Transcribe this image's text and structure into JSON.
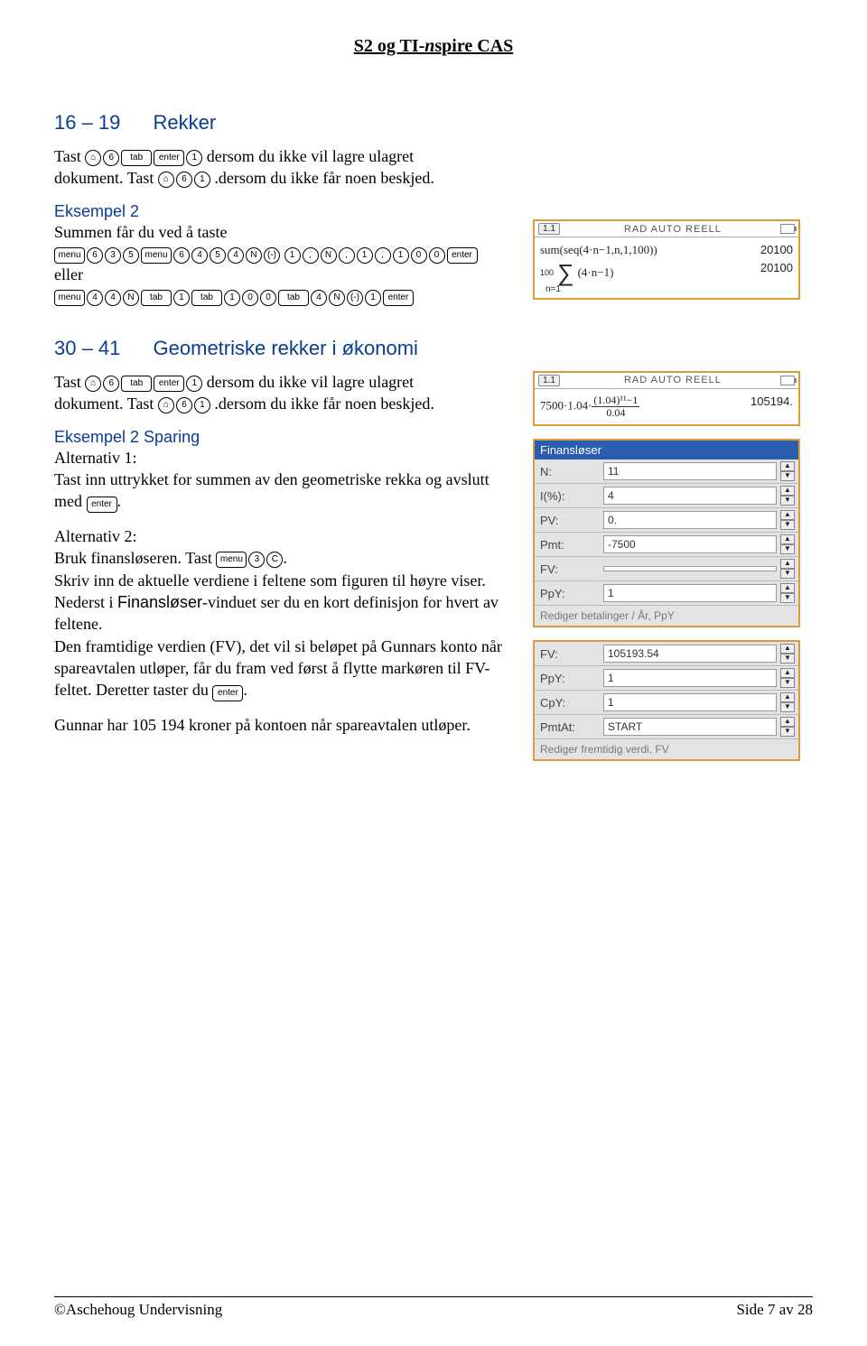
{
  "header": {
    "title_pre": "S2 og TI-",
    "title_n": "n",
    "title_post": "spire CAS"
  },
  "section1": {
    "num": "16 – 19",
    "title": "Rekker",
    "p1_a": "Tast ",
    "p1_keys": [
      "⌂",
      "6",
      "tab",
      "enter",
      "1"
    ],
    "p1_b": " dersom du ikke vil lagre ulagret",
    "p2_a": "dokument. Tast ",
    "p2_keys": [
      "⌂",
      "6",
      "1"
    ],
    "p2_b": ".dersom du ikke får noen beskjed.",
    "ex_title": "Eksempel 2",
    "ex_line1": "Summen får du ved å taste",
    "row1": [
      "menu",
      "6",
      "3",
      "5",
      "menu",
      "6",
      "4",
      "5",
      "4",
      "N",
      "(-)"
    ],
    "row2": [
      "1",
      ",",
      "N",
      ",",
      "1",
      ",",
      "1",
      "0",
      "0",
      "enter"
    ],
    "eller": "eller",
    "row3": [
      "menu",
      "4",
      "4",
      "N",
      "tab",
      "1",
      "tab",
      "1",
      "0",
      "0",
      "tab",
      "4",
      "N",
      "(-)",
      "1",
      "enter"
    ]
  },
  "calc1": {
    "tab": "1.1",
    "mode": "RAD AUTO REELL",
    "r1_l": "sum(seq(4·n−1,n,1,100))",
    "r1_r": "20100",
    "sigma_top": "100",
    "sigma_bot": "n=1",
    "sigma_expr": "(4·n−1)",
    "r2_r": "20100"
  },
  "section2": {
    "num": "30 – 41",
    "title": "Geometriske rekker i økonomi",
    "p1_a": "Tast ",
    "p1_keys": [
      "⌂",
      "6",
      "tab",
      "enter",
      "1"
    ],
    "p1_b": " dersom du ikke vil lagre ulagret",
    "p2_a": "dokument. Tast ",
    "p2_keys": [
      "⌂",
      "6",
      "1"
    ],
    "p2_b": ".dersom du ikke får noen beskjed.",
    "ex_title": "Eksempel 2 Sparing",
    "alt1_h": "Alternativ 1:",
    "alt1_t": "Tast inn uttrykket for summen av den geometriske rekka og avslutt med ",
    "alt1_key": "enter",
    "alt1_end": ".",
    "alt2_h": "Alternativ 2:",
    "alt2_a": "Bruk finansløseren. Tast ",
    "alt2_keys": [
      "menu",
      "3",
      "C"
    ],
    "alt2_b": ".",
    "alt2_c": "Skriv inn de aktuelle verdiene i feltene som figuren til høyre viser.",
    "alt2_d_pre": "Nederst i ",
    "alt2_d_sans": "Finansløser",
    "alt2_d_post": "-vinduet ser du en kort definisjon for hvert av feltene.",
    "alt2_e": "Den framtidige verdien (FV), det vil si beløpet på Gunnars konto når spareavtalen utløper, får du fram ved først å flytte markøren til FV-feltet. Deretter taster du ",
    "alt2_e_key": "enter",
    "alt2_e_end": ".",
    "result": "Gunnar har 105 194 kroner på kontoen når spareavtalen utløper."
  },
  "calc2": {
    "tab": "1.1",
    "mode": "RAD AUTO REELL",
    "expr_l_a": "7500·1.04·",
    "expr_l_frac_top": "(1.04)¹¹−1",
    "expr_l_frac_bot": "0.04",
    "expr_r": "105194."
  },
  "finans": {
    "title": "Finansløser",
    "rows": [
      {
        "label": "N:",
        "value": "11"
      },
      {
        "label": "I(%):",
        "value": "4"
      },
      {
        "label": "PV:",
        "value": "0."
      },
      {
        "label": "Pmt:",
        "value": "-7500"
      },
      {
        "label": "FV:",
        "value": ""
      },
      {
        "label": "PpY:",
        "value": "1"
      }
    ],
    "footer": "Rediger betalinger / År, PpY"
  },
  "finans2": {
    "rows": [
      {
        "label": "FV:",
        "value": "105193.54"
      },
      {
        "label": "PpY:",
        "value": "1"
      },
      {
        "label": "CpY:",
        "value": "1"
      },
      {
        "label": "PmtAt:",
        "value": "START"
      }
    ],
    "footer": "Rediger fremtidig verdi, FV"
  },
  "footer": {
    "left": "©Aschehoug Undervisning",
    "right": "Side 7 av 28"
  }
}
